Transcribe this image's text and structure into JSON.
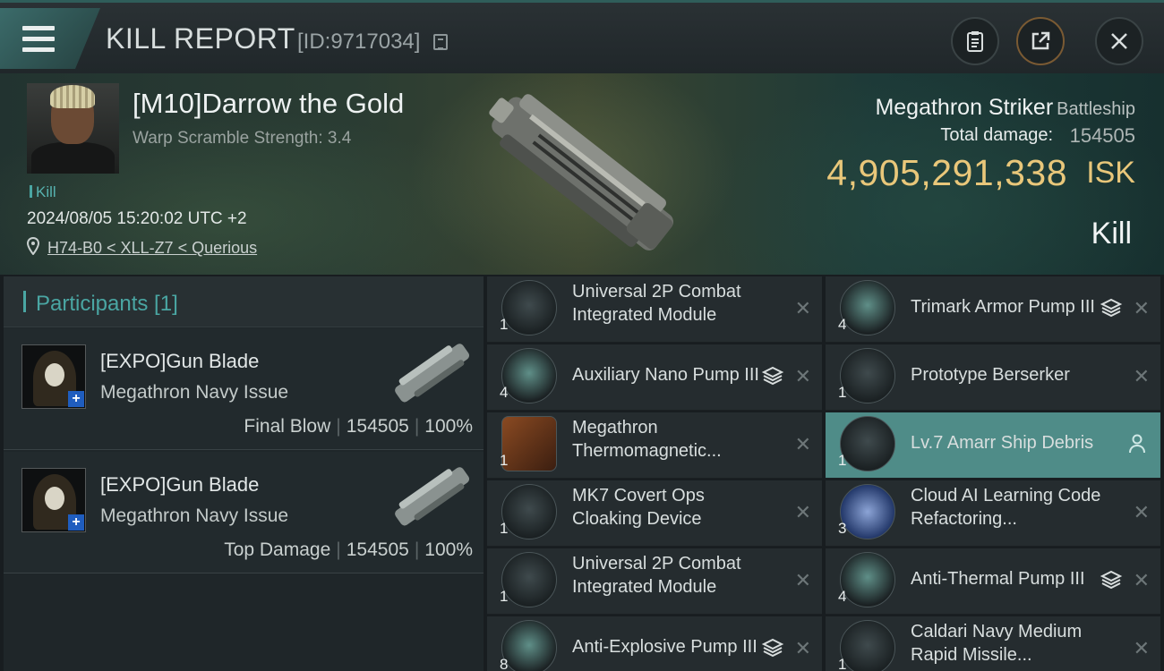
{
  "header": {
    "title": "KILL REPORT",
    "report_id": "[ID:9717034]"
  },
  "victim": {
    "name": "[M10]Darrow the Gold",
    "warp_scramble": "Warp Scramble Strength: 3.4",
    "tag": "Kill",
    "datetime": "2024/08/05 15:20:02 UTC +2",
    "location": "H74-B0 < XLL-Z7 < Querious",
    "ship_name": "Megathron Striker",
    "ship_class": "Battleship",
    "total_damage_label": "Total damage:",
    "total_damage": "154505",
    "isk_value": "4,905,291,338",
    "isk_unit": "ISK",
    "status": "Kill"
  },
  "participants": {
    "label": "Participants [1]",
    "rows": [
      {
        "name": "[EXPO]Gun Blade",
        "ship": "Megathron Navy Issue",
        "role": "Final Blow",
        "damage": "154505",
        "percent": "100%"
      },
      {
        "name": "[EXPO]Gun Blade",
        "ship": "Megathron Navy Issue",
        "role": "Top Damage",
        "damage": "154505",
        "percent": "100%"
      }
    ]
  },
  "modules": [
    {
      "name": "Universal 2P Combat Integrated Module",
      "qty": "1",
      "icon": "combat-module-icon",
      "stack": false,
      "col": 0
    },
    {
      "name": "Trimark Armor Pump III",
      "qty": "4",
      "icon": "armor-pump-icon",
      "stack": true,
      "col": 1
    },
    {
      "name": "Auxiliary Nano Pump III",
      "qty": "4",
      "icon": "nano-pump-icon",
      "stack": true,
      "col": 0
    },
    {
      "name": "Prototype  Berserker",
      "qty": "1",
      "icon": "drone-icon",
      "stack": false,
      "col": 1
    },
    {
      "name": "Megathron Thermomagnetic...",
      "qty": "1",
      "icon": "blueprint-icon",
      "stack": false,
      "col": 0
    },
    {
      "name": "Lv.7 Amarr Ship Debris",
      "qty": "1",
      "icon": "debris-icon",
      "stack": false,
      "col": 1,
      "highlight": true
    },
    {
      "name": "MK7 Covert Ops Cloaking Device",
      "qty": "1",
      "icon": "cloaking-device-icon",
      "stack": false,
      "col": 0
    },
    {
      "name": "Cloud AI Learning Code Refactoring...",
      "qty": "3",
      "icon": "ai-chip-icon",
      "stack": false,
      "col": 1
    },
    {
      "name": "Universal 2P Combat Integrated Module",
      "qty": "1",
      "icon": "combat-module-icon",
      "stack": false,
      "col": 0
    },
    {
      "name": "Anti-Thermal Pump III",
      "qty": "4",
      "icon": "thermal-pump-icon",
      "stack": true,
      "col": 1
    },
    {
      "name": "Anti-Explosive Pump III",
      "qty": "8",
      "icon": "explosive-pump-icon",
      "stack": true,
      "col": 0
    },
    {
      "name": "Caldari Navy Medium Rapid Missile...",
      "qty": "1",
      "icon": "missile-launcher-icon",
      "stack": false,
      "col": 1
    }
  ],
  "colors": {
    "accent": "#4aa6a3",
    "isk": "#e9c77a",
    "highlight_row": "#4f8c88"
  }
}
